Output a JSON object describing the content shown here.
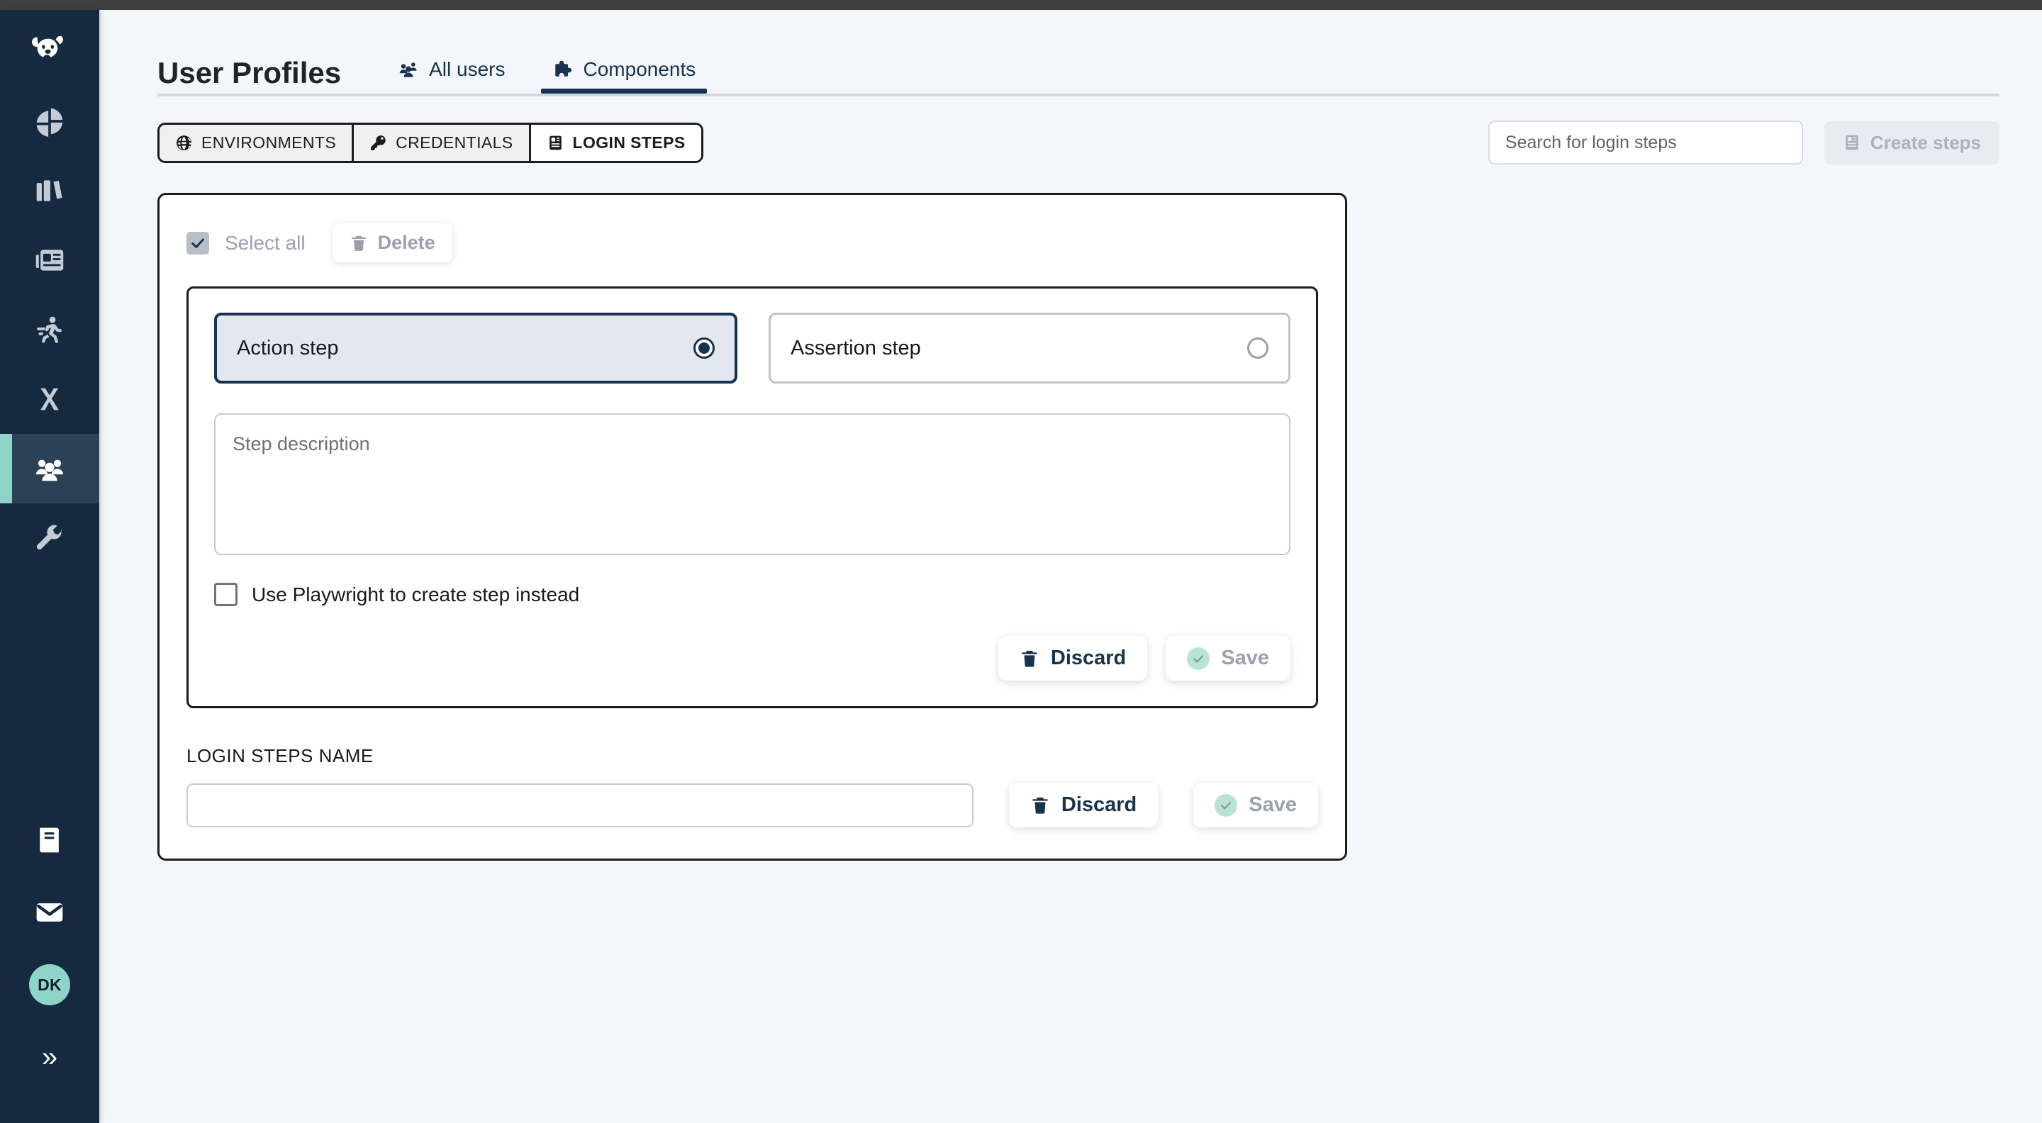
{
  "app": {
    "logo_icon": "koala-logo-icon",
    "accent_color": "#8ed4c8",
    "sidebar_bg": "#15293f",
    "page_bg": "#f3f6fa"
  },
  "sidebar": {
    "items": [
      {
        "icon": "pie-chart-icon",
        "name": "sidebar-item-dashboard",
        "active": false
      },
      {
        "icon": "books-icon",
        "name": "sidebar-item-library",
        "active": false
      },
      {
        "icon": "newspaper-icon",
        "name": "sidebar-item-reports",
        "active": false
      },
      {
        "icon": "runner-icon",
        "name": "sidebar-item-runs",
        "active": false
      },
      {
        "icon": "x-icon",
        "name": "sidebar-item-x",
        "active": false
      },
      {
        "icon": "users-icon",
        "name": "sidebar-item-user-profiles",
        "active": true
      },
      {
        "icon": "wrench-icon",
        "name": "sidebar-item-settings",
        "active": false
      }
    ],
    "bottom": {
      "docs_icon": "book-docs-icon",
      "mail_icon": "envelope-icon",
      "avatar_initials": "DK",
      "expand_icon": "double-chevron-right-icon"
    }
  },
  "header": {
    "title": "User Profiles",
    "tabs": [
      {
        "label": "All users",
        "icon": "users-icon",
        "active": false
      },
      {
        "label": "Components",
        "icon": "puzzle-piece-icon",
        "active": true
      }
    ]
  },
  "toolbar": {
    "segments": [
      {
        "label": "ENVIRONMENTS",
        "icon": "globe-icon",
        "active": false
      },
      {
        "label": "CREDENTIALS",
        "icon": "key-icon",
        "active": false
      },
      {
        "label": "LOGIN STEPS",
        "icon": "card-icon",
        "active": true
      }
    ],
    "search": {
      "placeholder": "Search for login steps",
      "value": ""
    },
    "create_button": {
      "label": "Create steps",
      "icon": "card-icon",
      "disabled": true
    }
  },
  "panel": {
    "select_all_label": "Select all",
    "delete_label": "Delete",
    "delete_icon": "trash-icon",
    "step": {
      "options": [
        {
          "label": "Action step",
          "selected": true
        },
        {
          "label": "Assertion step",
          "selected": false
        }
      ],
      "description": {
        "placeholder": "Step description",
        "value": ""
      },
      "playwright_checkbox": {
        "label": "Use Playwright to create step instead",
        "checked": false
      },
      "discard_label": "Discard",
      "save_label": "Save"
    },
    "name_section": {
      "label": "LOGIN STEPS NAME",
      "input_value": "",
      "discard_label": "Discard",
      "save_label": "Save"
    }
  }
}
